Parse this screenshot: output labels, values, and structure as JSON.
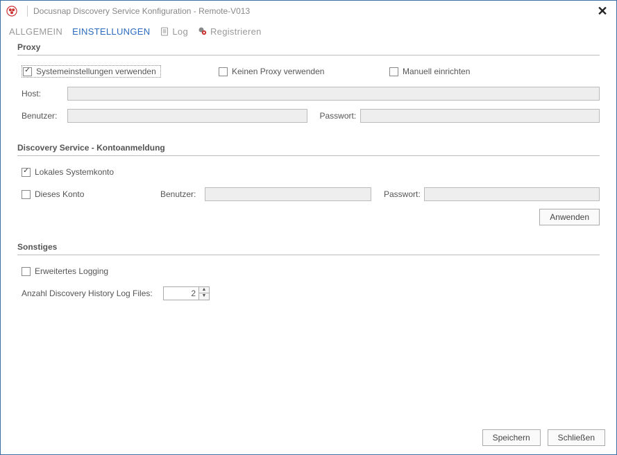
{
  "window": {
    "title": "Docusnap Discovery Service Konfiguration - Remote-V013"
  },
  "tabs": {
    "allgemein": "ALLGEMEIN",
    "einstellungen": "EINSTELLUNGEN",
    "log": "Log",
    "registrieren": "Registrieren"
  },
  "proxy": {
    "heading": "Proxy",
    "use_system": "Systemeinstellungen verwenden",
    "no_proxy": "Keinen Proxy verwenden",
    "manual": "Manuell einrichten",
    "host_label": "Host:",
    "user_label": "Benutzer:",
    "pass_label": "Passwort:",
    "host_value": "",
    "user_value": "",
    "pass_value": ""
  },
  "account": {
    "heading": "Discovery Service - Kontoanmeldung",
    "local_system": "Lokales Systemkonto",
    "this_account": "Dieses Konto",
    "user_label": "Benutzer:",
    "pass_label": "Passwort:",
    "user_value": "",
    "pass_value": "",
    "apply": "Anwenden"
  },
  "misc": {
    "heading": "Sonstiges",
    "extended_logging": "Erweitertes Logging",
    "history_label": "Anzahl Discovery History Log Files:",
    "history_value": "2"
  },
  "footer": {
    "save": "Speichern",
    "close": "Schließen"
  }
}
